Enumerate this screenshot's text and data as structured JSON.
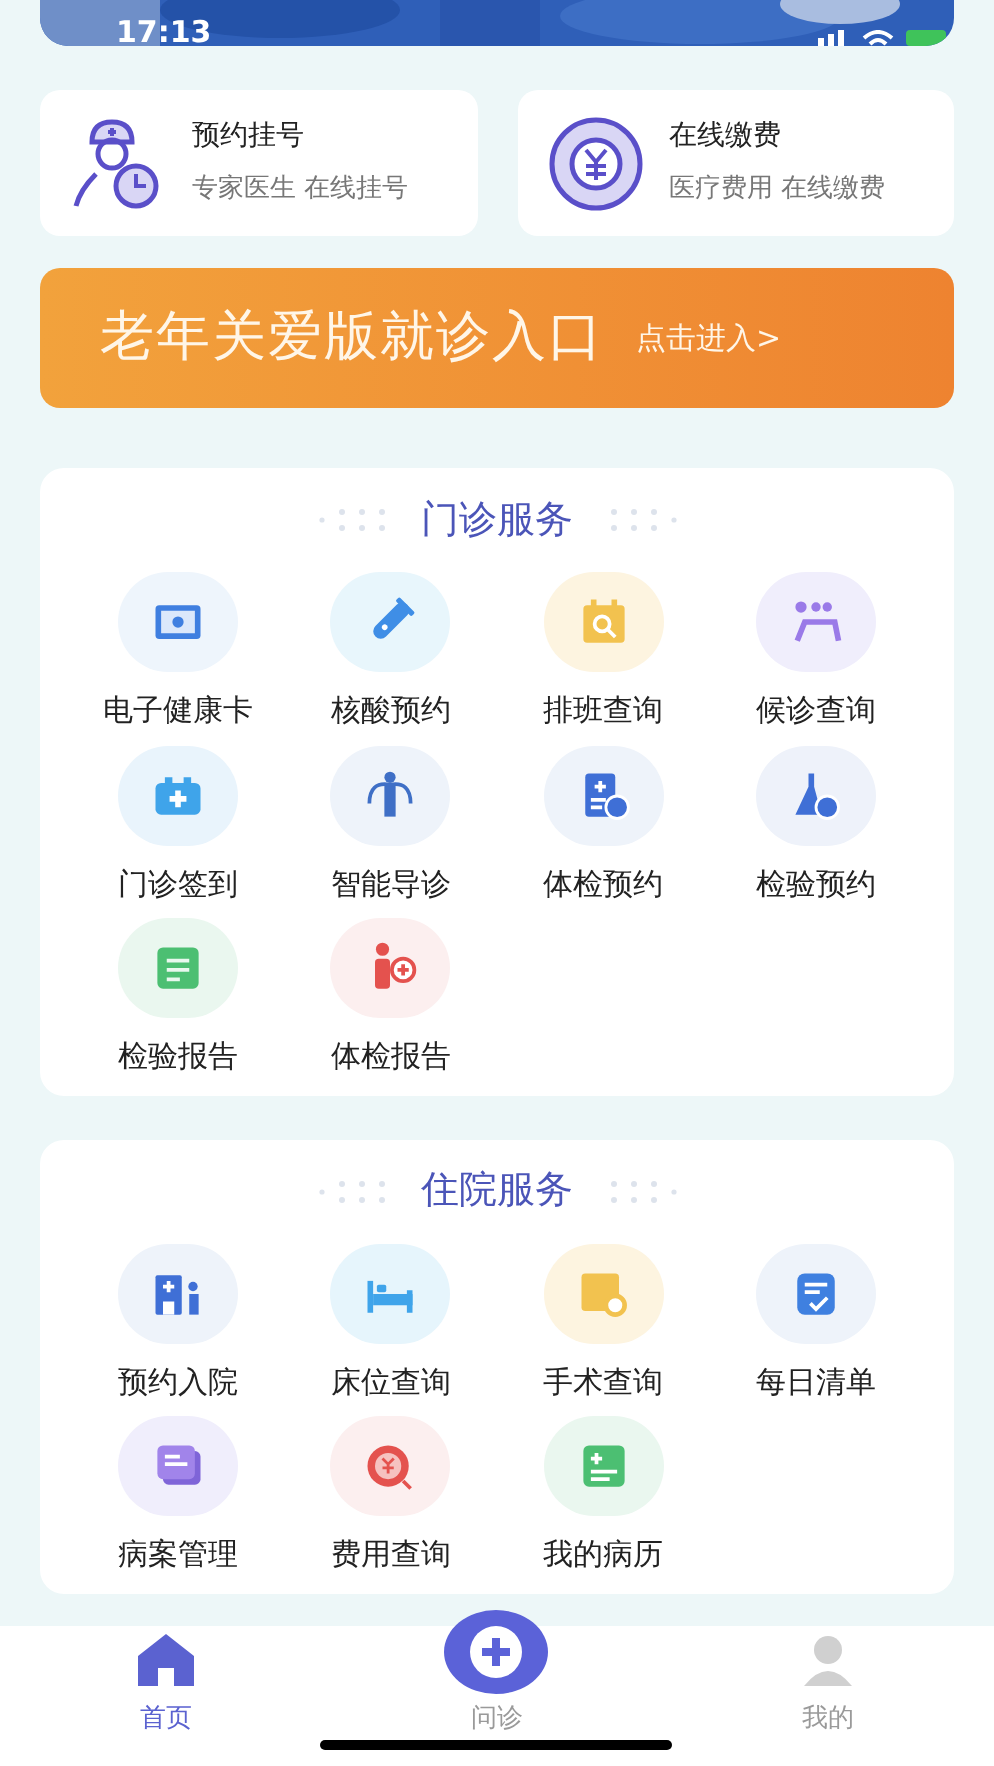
{
  "status_bar": {
    "time": "17:13"
  },
  "quick_cards": [
    {
      "title": "预约挂号",
      "subtitle": "专家医生 在线挂号"
    },
    {
      "title": "在线缴费",
      "subtitle": "医疗费用 在线缴费"
    }
  ],
  "elder_banner": {
    "title": "老年关爱版就诊入口",
    "action": "点击进入>"
  },
  "sections": [
    {
      "title": "门诊服务",
      "items": [
        {
          "label": "电子健康卡"
        },
        {
          "label": "核酸预约"
        },
        {
          "label": "排班查询"
        },
        {
          "label": "候诊查询"
        },
        {
          "label": "门诊签到"
        },
        {
          "label": "智能导诊"
        },
        {
          "label": "体检预约"
        },
        {
          "label": "检验预约"
        },
        {
          "label": "检验报告"
        },
        {
          "label": "体检报告"
        }
      ]
    },
    {
      "title": "住院服务",
      "items": [
        {
          "label": "预约入院"
        },
        {
          "label": "床位查询"
        },
        {
          "label": "手术查询"
        },
        {
          "label": "每日清单"
        },
        {
          "label": "病案管理"
        },
        {
          "label": "费用查询"
        },
        {
          "label": "我的病历"
        }
      ]
    }
  ],
  "tab_bar": [
    {
      "label": "首页",
      "selected": true,
      "kind": "home"
    },
    {
      "label": "问诊",
      "selected": false,
      "kind": "center"
    },
    {
      "label": "我的",
      "selected": false,
      "kind": "profile"
    }
  ]
}
